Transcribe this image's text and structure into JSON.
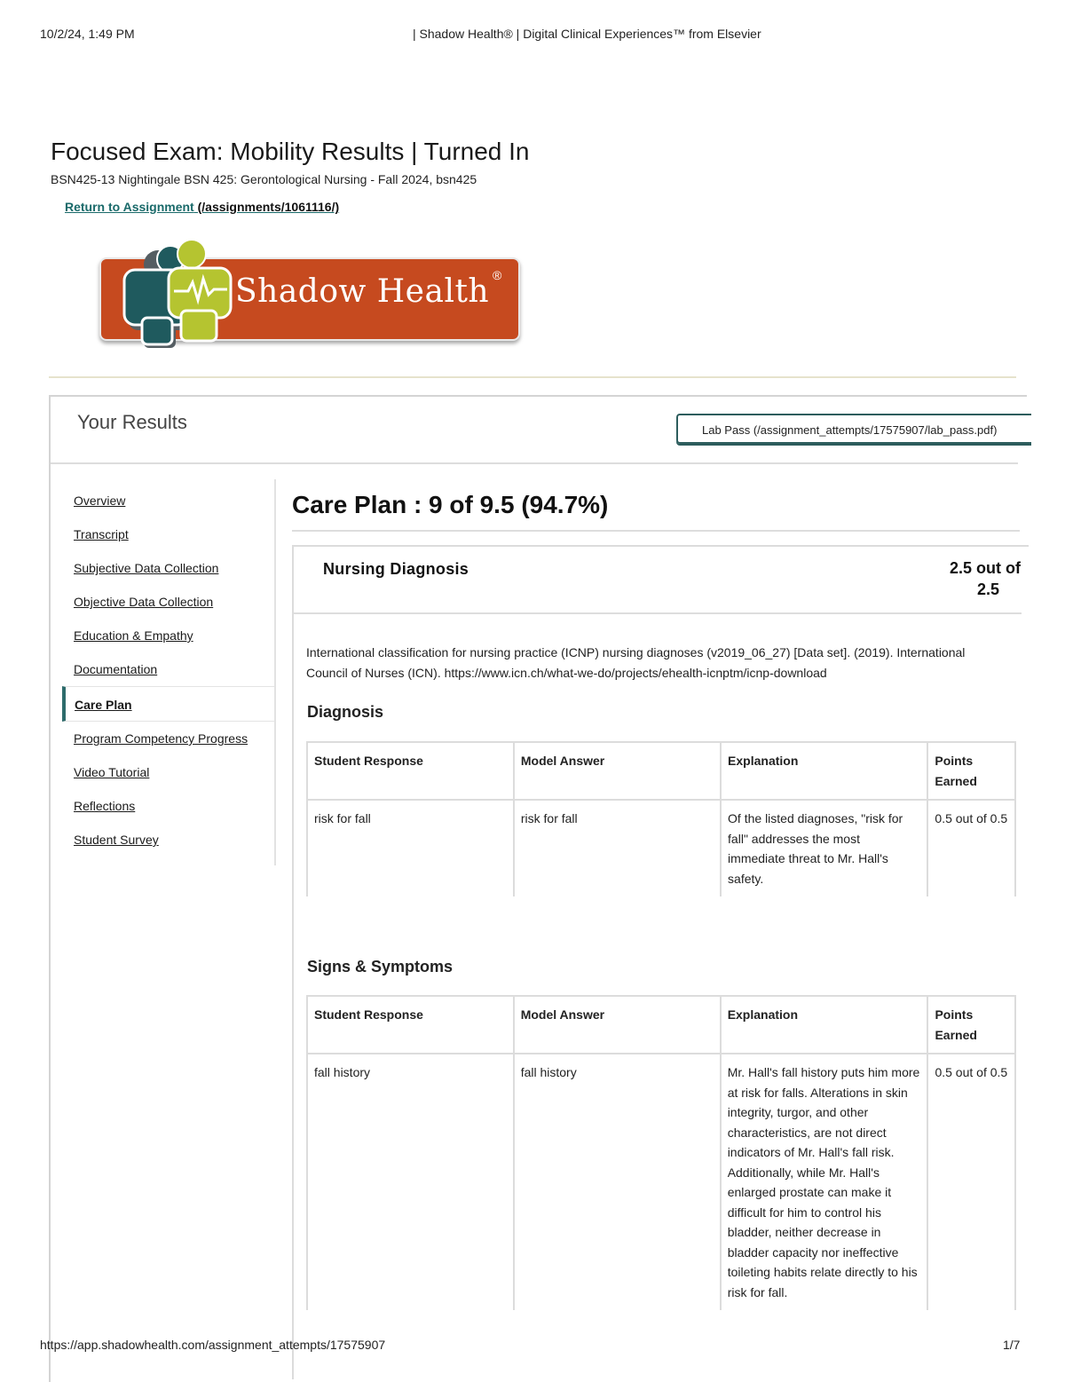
{
  "print_header": {
    "datetime": "10/2/24, 1:49 PM",
    "title": "| Shadow Health® | Digital Clinical Experiences™ from Elsevier"
  },
  "page": {
    "title": "Focused Exam: Mobility Results | Turned In",
    "course": "BSN425-13 Nightingale BSN 425: Gerontological Nursing - Fall 2024, bsn425",
    "return_link": "Return to Assignment",
    "return_url": " (/assignments/1061116/)"
  },
  "logo": {
    "text": "Shadow Health",
    "reg": "®"
  },
  "results": {
    "heading": "Your Results",
    "lab_pass": "Lab Pass (/assignment_attempts/17575907/lab_pass.pdf)"
  },
  "sidebar": {
    "items": [
      {
        "label": "Overview"
      },
      {
        "label": "Transcript"
      },
      {
        "label": "Subjective Data Collection"
      },
      {
        "label": "Objective Data Collection"
      },
      {
        "label": "Education & Empathy"
      },
      {
        "label": "Documentation"
      },
      {
        "label": "Care Plan",
        "active": true
      },
      {
        "label": "Program Competency Progress"
      },
      {
        "label": "Video Tutorial"
      },
      {
        "label": "Reflections"
      },
      {
        "label": "Student Survey"
      }
    ]
  },
  "care_plan": {
    "title": "Care Plan : 9 of 9.5 (94.7%)",
    "section": {
      "title": "Nursing Diagnosis",
      "score_line1": "2.5 out of",
      "score_line2": "2.5",
      "citation": "International classification for nursing practice (ICNP) nursing diagnoses (v2019_06_27) [Data set]. (2019). International Council of Nurses (ICN). https://www.icn.ch/what-we-do/projects/ehealth-icnptm/icnp-download"
    },
    "headers": [
      "Student Response",
      "Model Answer",
      "Explanation",
      "Points Earned"
    ],
    "diagnosis": {
      "title": "Diagnosis",
      "rows": [
        [
          "risk for fall",
          "risk for fall",
          "Of the listed diagnoses, \"risk for fall\" addresses the most immediate threat to Mr. Hall's safety.",
          "0.5 out of 0.5"
        ]
      ]
    },
    "signs": {
      "title": "Signs & Symptoms",
      "rows": [
        [
          "fall history",
          "fall history",
          "Mr. Hall's fall history puts him more at risk for falls. Alterations in skin integrity, turgor, and other characteristics, are not direct indicators of Mr. Hall's fall risk. Additionally, while Mr. Hall's enlarged prostate can make it difficult for him to control his bladder, neither decrease in bladder capacity nor ineffective toileting habits relate directly to his risk for fall.",
          "0.5 out of 0.5"
        ]
      ]
    }
  },
  "print_footer": {
    "url": "https://app.shadowhealth.com/assignment_attempts/17575907",
    "page": "1/7"
  },
  "colors": {
    "accent": "#2d6b6b",
    "logo_orange": "#c64a1f",
    "logo_lime": "#b5c430",
    "logo_teal": "#1f5a5e"
  }
}
